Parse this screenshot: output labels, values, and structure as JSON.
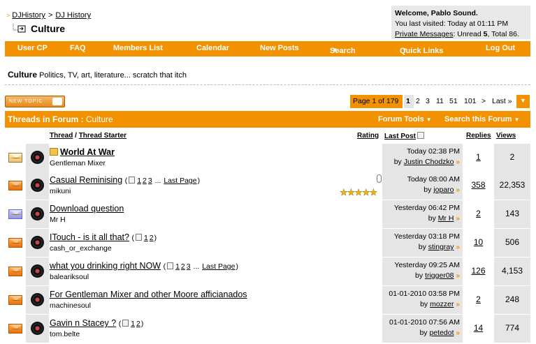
{
  "breadcrumb": [
    "DJHistory",
    "DJ History"
  ],
  "current_forum": "Culture",
  "welcome": {
    "greeting": "Welcome, Pablo Sound.",
    "last_visited": "You last visited: Today at 01:11 PM",
    "pm_label": "Private Messages",
    "pm_rest": ": Unread ",
    "pm_unread": "5",
    "pm_total_label": ", Total 86."
  },
  "nav": [
    "User CP",
    "FAQ",
    "Members List",
    "Calendar",
    "New Posts",
    "Search",
    "Quick Links",
    "Log Out"
  ],
  "forum_description": {
    "name": "Culture",
    "text": "Politics, TV, art, literature... scratch that itch"
  },
  "new_topic_label": "NEW TOPIC",
  "pager": {
    "info": "Page 1 of 179",
    "current": "1",
    "pages": [
      "2",
      "3",
      "11",
      "51",
      "101",
      ">",
      "Last »"
    ]
  },
  "forum_header": {
    "prefix": "Threads in Forum : ",
    "name": "Culture",
    "tools": "Forum Tools",
    "search": "Search this Forum"
  },
  "columns": {
    "thread": "Thread",
    "sep": " / ",
    "starter": "Thread Starter",
    "rating": "Rating",
    "last_post": "Last Post",
    "replies": "Replies",
    "views": "Views"
  },
  "threads": [
    {
      "title": "World At War",
      "starter": "Gentleman Mixer",
      "pages": [],
      "last_page": "",
      "last_date": "Today 02:38 PM",
      "last_by": "Justin Chodzko",
      "replies": "1",
      "views": "2",
      "status": "hot",
      "rating": 0,
      "bold": true
    },
    {
      "title": "Casual Reminising",
      "starter": "mikuni",
      "pages": [
        "1",
        "2",
        "3"
      ],
      "last_page": "Last Page",
      "last_date": "Today 08:00 AM",
      "last_by": "joparo",
      "replies": "358",
      "views": "22,353",
      "status": "new",
      "rating": 5,
      "attachment": true
    },
    {
      "title": "Download question",
      "starter": "Mr H",
      "pages": [],
      "last_page": "",
      "last_date": "Yesterday 06:42 PM",
      "last_by": "Mr H",
      "replies": "2",
      "views": "143",
      "status": "read",
      "rating": 0
    },
    {
      "title": "ITouch - is it all that?",
      "starter": "cash_or_exchange",
      "pages": [
        "1",
        "2"
      ],
      "last_page": "",
      "last_date": "Yesterday 03:18 PM",
      "last_by": "stingray",
      "replies": "10",
      "views": "506",
      "status": "new",
      "rating": 0
    },
    {
      "title": "what you drinking right NOW",
      "starter": "baleariksoul",
      "pages": [
        "1",
        "2",
        "3"
      ],
      "last_page": "Last Page",
      "last_date": "Yesterday 09:25 AM",
      "last_by": "trigger08",
      "replies": "126",
      "views": "4,153",
      "status": "new",
      "rating": 0
    },
    {
      "title": "For Gentleman Mixer and other Moore afficianados",
      "starter": "machinesoul",
      "pages": [],
      "last_page": "",
      "last_date": "01-01-2010 03:58 PM",
      "last_by": "mozzer",
      "replies": "2",
      "views": "248",
      "status": "new",
      "rating": 0
    },
    {
      "title": "Gavin n Stacey ?",
      "starter": "tom.belte",
      "pages": [
        "1",
        "2"
      ],
      "last_page": "",
      "last_date": "01-01-2010 07:56 AM",
      "last_by": "petedot",
      "replies": "14",
      "views": "774",
      "status": "new",
      "rating": 0
    }
  ],
  "colors": {
    "accent": "#f39200",
    "cell_alt": "#e5e5e5",
    "panel": "#e8e8e8"
  },
  "icons": {
    "status": "envelope-icon",
    "thread": "vinyl-record-icon",
    "go": "go-to-last-post-icon",
    "attachment": "paperclip-icon",
    "multipage": "multipage-icon"
  }
}
